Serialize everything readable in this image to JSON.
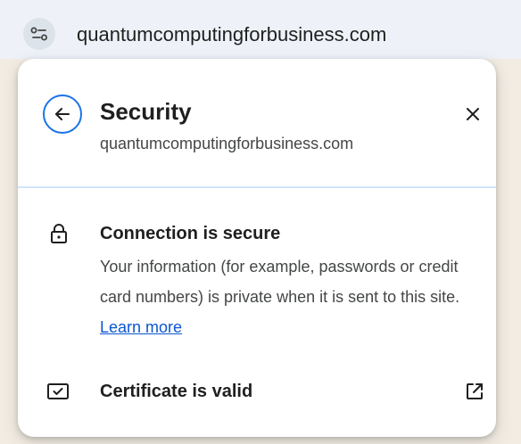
{
  "omnibox": {
    "url": "quantumcomputingforbusiness.com",
    "site_settings_icon": "tune-icon"
  },
  "popup": {
    "back_icon": "arrow-left-icon",
    "title": "Security",
    "subtitle": "quantumcomputingforbusiness.com",
    "close_icon": "close-icon",
    "connection": {
      "icon": "lock-icon",
      "title": "Connection is secure",
      "body": "Your information (for example, passwords or credit card numbers) is private when it is sent to this site.",
      "link_label": "Learn more"
    },
    "certificate": {
      "icon": "certificate-icon",
      "label": "Certificate is valid",
      "external_icon": "open-in-new-icon"
    }
  },
  "colors": {
    "accent": "#1a73e8",
    "link": "#0b57d0",
    "divider": "#d3e3fd",
    "omnibox_bg": "#eef2f8"
  }
}
